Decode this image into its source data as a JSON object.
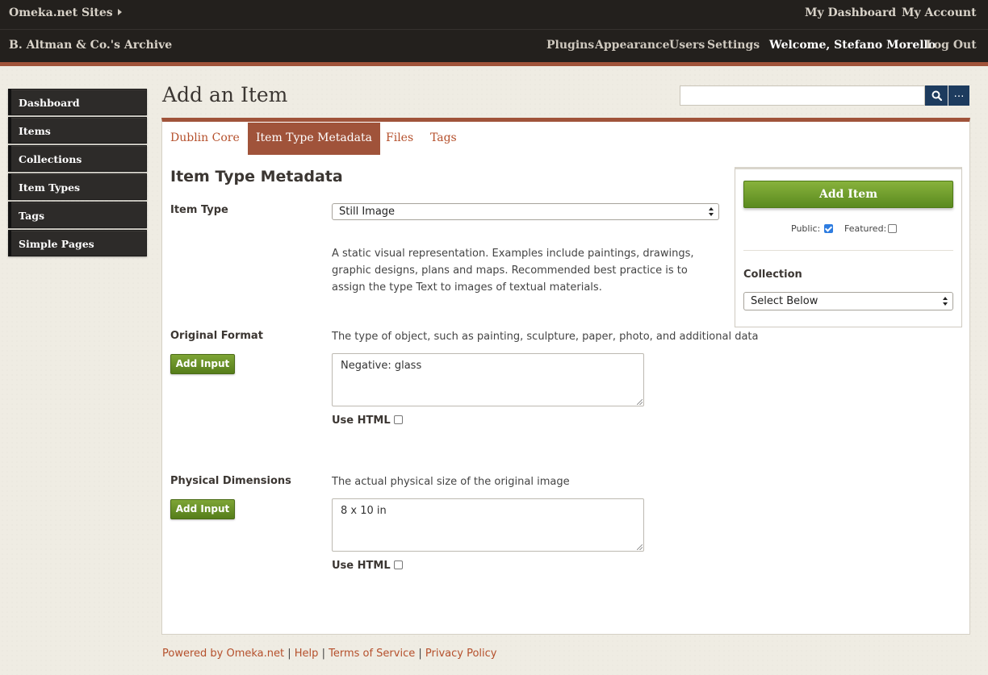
{
  "topbar": {
    "sites_label": "Omeka.net Sites",
    "my_dashboard": "My Dashboard",
    "my_account": "My Account"
  },
  "sitebar": {
    "site_title": "B. Altman & Co.'s Archive",
    "nav": [
      "Plugins",
      "Appearance",
      "Users",
      "Settings"
    ],
    "welcome": "Welcome, Stefano Morello",
    "logout": "Log Out"
  },
  "sidebar": {
    "items": [
      "Dashboard",
      "Items",
      "Collections",
      "Item Types",
      "Tags",
      "Simple Pages"
    ]
  },
  "page": {
    "title": "Add an Item"
  },
  "search": {
    "value": "",
    "advanced_label": "…"
  },
  "tabs": [
    {
      "label": "Dublin Core",
      "active": false
    },
    {
      "label": "Item Type Metadata",
      "active": true
    },
    {
      "label": "Files",
      "active": false
    },
    {
      "label": "Tags",
      "active": false
    }
  ],
  "form": {
    "section_title": "Item Type Metadata",
    "item_type": {
      "label": "Item Type",
      "selected": "Still Image",
      "description": "A static visual representation. Examples include paintings, drawings, graphic designs, plans and maps. Recommended best practice is to assign the type Text to images of textual materials."
    },
    "fields": [
      {
        "label": "Original Format",
        "description": "The type of object, such as painting, sculpture, paper, photo, and additional data",
        "add_input": "Add Input",
        "value": "Negative: glass",
        "use_html": "Use HTML"
      },
      {
        "label": "Physical Dimensions",
        "description": "The actual physical size of the original image",
        "add_input": "Add Input",
        "value": "8 x 10 in",
        "use_html": "Use HTML"
      }
    ]
  },
  "save_panel": {
    "add_item": "Add Item",
    "public_label": "Public:",
    "public_checked": true,
    "featured_label": "Featured:",
    "featured_checked": false,
    "collection_label": "Collection",
    "collection_selected": "Select Below"
  },
  "footer": {
    "powered": "Powered by Omeka.net",
    "help": "Help",
    "terms": "Terms of Service",
    "privacy": "Privacy Policy",
    "separator": "|"
  },
  "colors": {
    "accent": "#a0533a",
    "link": "#b5502c",
    "green": "#6b9a26",
    "nav_dark": "#23201d",
    "search_blue": "#1d3b5e"
  }
}
